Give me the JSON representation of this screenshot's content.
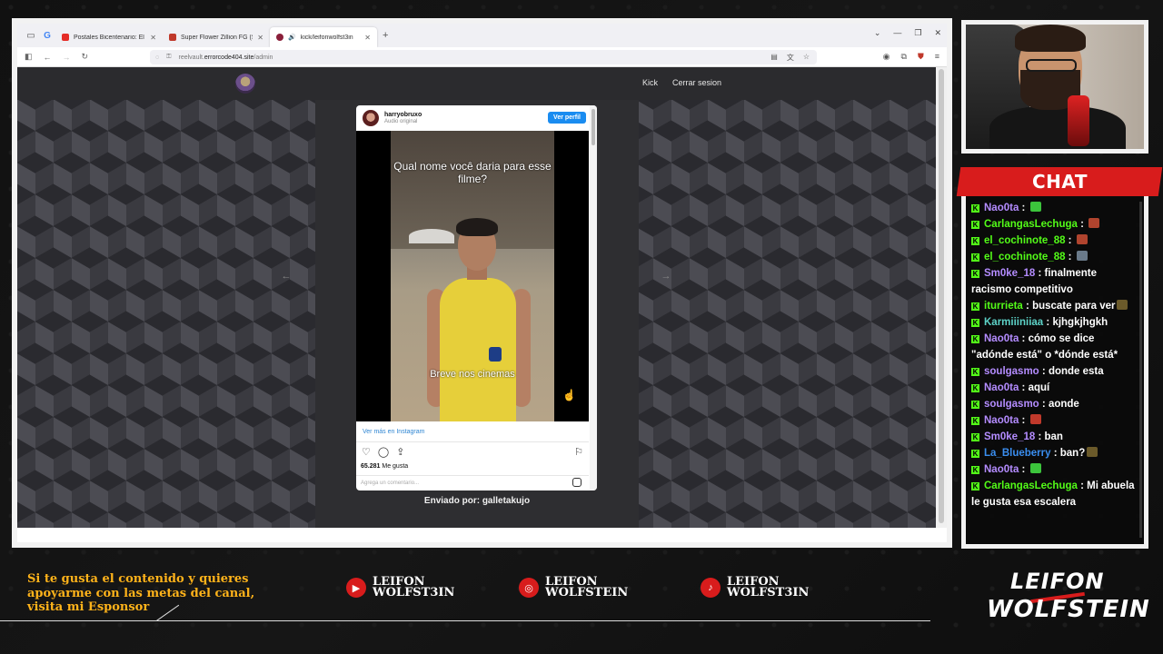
{
  "browser": {
    "tabs": [
      {
        "title": "Postales Bicentenario: El psicop",
        "color": "#e52d27",
        "active": false
      },
      {
        "title": "Super Flower Zillion FG (SF-12",
        "color": "#c0392b",
        "active": false
      },
      {
        "title": "kick/leifonwolfst3in",
        "color": "#8a1f3a",
        "active": true
      }
    ],
    "new_tab_icon": "+",
    "url_prefix": "reelvault.",
    "url_host": "errorcode404.site",
    "url_path": "/admin"
  },
  "site": {
    "nav_links": [
      "Kick",
      "Cerrar sesion"
    ],
    "sender_label": "Enviado por: galletakujo"
  },
  "embed": {
    "username": "harryobruxo",
    "audio_label": "Audio original",
    "profile_button": "Ver perfil",
    "caption_top": "Qual nome você daria para esse filme?",
    "caption_bottom": "Breve nos cinemas",
    "more_link": "Ver más en Instagram",
    "likes_count": "65.281",
    "likes_label": "Me gusta",
    "comment_placeholder": "Agrega un comentario..."
  },
  "chat": {
    "title": "CHAT",
    "messages": [
      {
        "user": "Nao0ta",
        "user_color": "#b48cff",
        "text": "",
        "emote_color": "#3cc43c"
      },
      {
        "user": "CarlangasLechuga",
        "user_color": "#53fc18",
        "text": "",
        "emote_color": "#b0442e"
      },
      {
        "user": "el_cochinote_88",
        "user_color": "#53fc18",
        "text": "",
        "emote_color": "#b0442e"
      },
      {
        "user": "el_cochinote_88",
        "user_color": "#53fc18",
        "text": "",
        "emote_color": "#6a7a8a"
      },
      {
        "user": "Sm0ke_18",
        "user_color": "#b48cff",
        "text": "finalmente racismo competitivo"
      },
      {
        "user": "iturrieta",
        "user_color": "#53fc18",
        "text": "buscate para ver",
        "emote_color": "#6b5a2a"
      },
      {
        "user": "Karmiiiniiaa",
        "user_color": "#5dd3c8",
        "text": "kjhgkjhgkh"
      },
      {
        "user": "Nao0ta",
        "user_color": "#b48cff",
        "text": "cómo se dice \"adónde está\" o *dónde está*"
      },
      {
        "user": "soulgasmo",
        "user_color": "#b48cff",
        "text": "donde esta"
      },
      {
        "user": "Nao0ta",
        "user_color": "#b48cff",
        "text": "aquí"
      },
      {
        "user": "soulgasmo",
        "user_color": "#b48cff",
        "text": "aonde"
      },
      {
        "user": "Nao0ta",
        "user_color": "#b48cff",
        "text": "",
        "emote_color": "#c0392b"
      },
      {
        "user": "Sm0ke_18",
        "user_color": "#b48cff",
        "text": "ban"
      },
      {
        "user": "La_Blueberry",
        "user_color": "#3a8ef0",
        "text": "ban?",
        "emote_color": "#6b5a2a"
      },
      {
        "user": "Nao0ta",
        "user_color": "#b48cff",
        "text": "",
        "emote_color": "#3cc43c"
      },
      {
        "user": "CarlangasLechuga",
        "user_color": "#53fc18",
        "text": "Mi abuela le gusta esa escalera"
      }
    ]
  },
  "overlay": {
    "promo_lines": [
      "Si te gusta el contenido y quieres",
      "apoyarme con las metas del canal,",
      "visita mi Esponsor"
    ],
    "socials": [
      {
        "icon": "youtube-icon",
        "glyph": "▶",
        "line1": "LEIFON",
        "line2": "WOLFST3IN"
      },
      {
        "icon": "instagram-icon",
        "glyph": "◎",
        "line1": "LEIFON",
        "line2": "WOLFSTEIN"
      },
      {
        "icon": "tiktok-icon",
        "glyph": "♪",
        "line1": "LEIFON",
        "line2": "WOLFST3IN"
      }
    ],
    "brand_line1": "LEIFON",
    "brand_line2": "WOLFSTEIN"
  },
  "colors": {
    "accent_red": "#d81c1c",
    "promo_orange": "#ffb31a",
    "kick_green": "#53fc18",
    "instagram_blue": "#1a8cf0"
  }
}
